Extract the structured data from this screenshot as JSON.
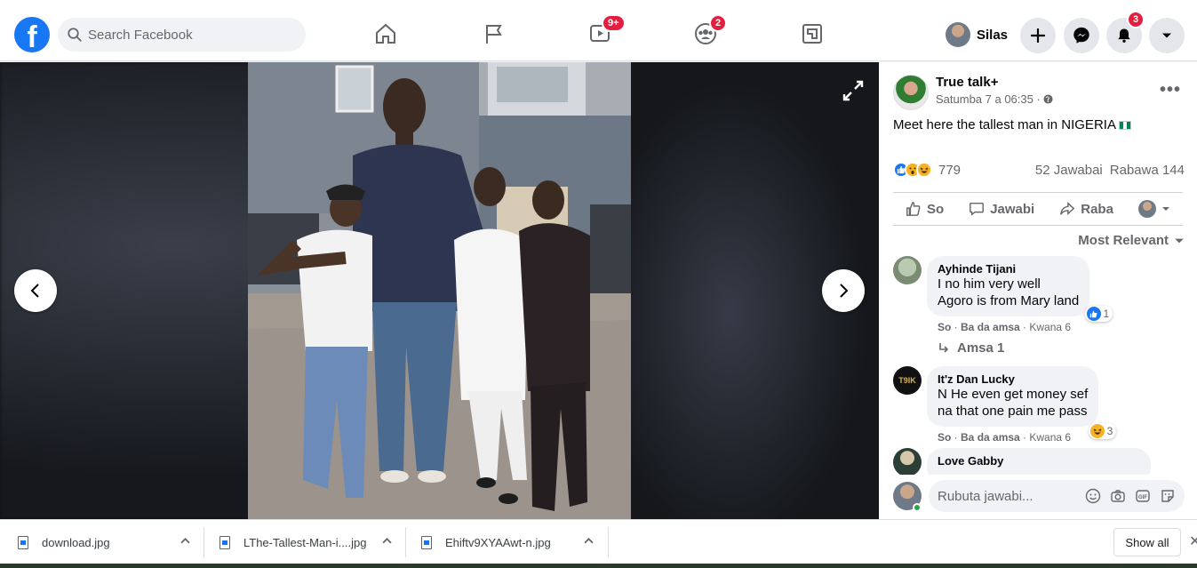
{
  "header": {
    "search_placeholder": "Search Facebook",
    "nav_badges": {
      "watch": "9+",
      "groups": "2"
    },
    "profile_name": "Silas",
    "notifications_badge": "3"
  },
  "post": {
    "author": "True talk+",
    "time": "Satumba 7 a 06:35 ·",
    "text": "Meet here the tallest man in NIGERIA",
    "reaction_count": "779",
    "comments_count": "52 Jawabai",
    "shares_count": "Rabawa 144",
    "actions": {
      "like": "So",
      "comment": "Jawabi",
      "share": "Raba"
    },
    "sort_label": "Most Relevant"
  },
  "comments": [
    {
      "name": "Ayhinde Tijani",
      "lines": [
        "I no him very well",
        "Agoro is from Mary land"
      ],
      "reaction_count": "1",
      "like": "So",
      "reply": "Ba da amsa",
      "time": "Kwana 6",
      "replies_label": "Amsa 1"
    },
    {
      "name": "It'z Dan Lucky",
      "avatar_text": "T9IK",
      "lines": [
        "N He even get money sef",
        "na that one pain me pass"
      ],
      "reaction_count": "3",
      "like": "So",
      "reply": "Ba da amsa",
      "time": "Kwana 6"
    },
    {
      "name": "Love Gabby",
      "lines": []
    }
  ],
  "compose": {
    "placeholder": "Rubuta jawabi..."
  },
  "downloads": {
    "items": [
      "download.jpg",
      "LThe-Tallest-Man-i....jpg",
      "Ehiftv9XYAAwt-n.jpg"
    ],
    "show_all": "Show all"
  },
  "colors": {
    "brand": "#1877f2",
    "badge": "#e41e3f",
    "panel_bg": "#ffffff"
  }
}
